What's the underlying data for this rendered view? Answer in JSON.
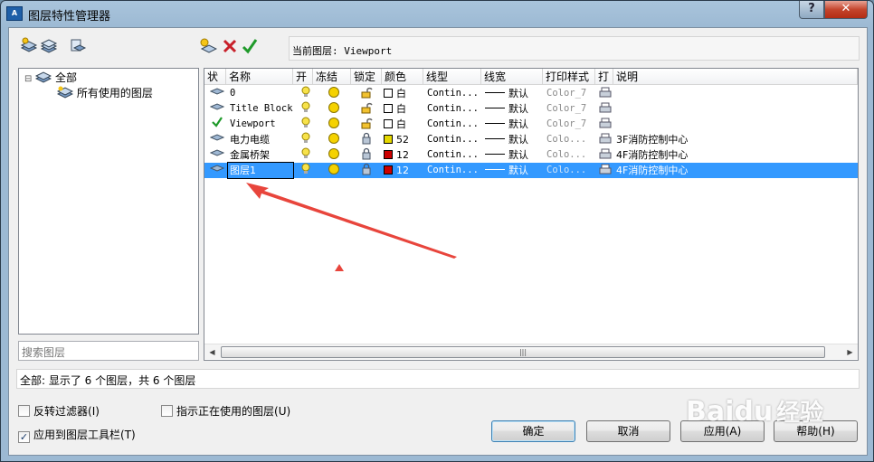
{
  "window": {
    "title": "图层特性管理器",
    "app_icon_text": "A",
    "help_button": "?",
    "close_button": "✕"
  },
  "toolbar": {
    "current_layer_label": "当前图层:",
    "current_layer_value": "Viewport"
  },
  "tree": {
    "root": "全部",
    "child": "所有使用的图层",
    "root_toggle": "⊟"
  },
  "search": {
    "placeholder": "搜索图层"
  },
  "columns": [
    "状",
    "名称",
    "开",
    "冻结",
    "锁定",
    "颜色",
    "线型",
    "线宽",
    "打印样式",
    "打",
    "说明"
  ],
  "layers": [
    {
      "status": "layer",
      "name": "0",
      "color_hex": "#ffffff",
      "color": "白",
      "linetype": "Contin...",
      "lineweight": "默认",
      "plot_style": "Color_7",
      "desc": "",
      "locked": false
    },
    {
      "status": "layer",
      "name": "Title Block",
      "color_hex": "#ffffff",
      "color": "白",
      "linetype": "Contin...",
      "lineweight": "默认",
      "plot_style": "Color_7",
      "desc": "",
      "locked": false
    },
    {
      "status": "current",
      "name": "Viewport",
      "color_hex": "#ffffff",
      "color": "白",
      "linetype": "Contin...",
      "lineweight": "默认",
      "plot_style": "Color_7",
      "desc": "",
      "locked": false
    },
    {
      "status": "layer",
      "name": "电力电缆",
      "color_hex": "#e5d800",
      "color": "52",
      "linetype": "Contin...",
      "lineweight": "默认",
      "plot_style": "Colo...",
      "desc": "3F消防控制中心",
      "locked": true
    },
    {
      "status": "layer",
      "name": "金属桥架",
      "color_hex": "#cc0000",
      "color": "12",
      "linetype": "Contin...",
      "lineweight": "默认",
      "plot_style": "Colo...",
      "desc": "4F消防控制中心",
      "locked": true
    },
    {
      "status": "layer",
      "name": "图层1",
      "color_hex": "#cc0000",
      "color": "12",
      "linetype": "Contin...",
      "lineweight": "默认",
      "plot_style": "Colo...",
      "desc": "4F消防控制中心",
      "locked": true,
      "selected": true
    }
  ],
  "scrollbar": {
    "left": "◀",
    "right": "▶",
    "grip": "|||"
  },
  "status_text": "全部: 显示了 6 个图层，共 6 个图层",
  "options": {
    "invert_filter": "反转过滤器",
    "invert_filter_key": "(I)",
    "invert_checked": false,
    "show_in_use": "指示正在使用的图层",
    "show_in_use_key": "(U)",
    "show_in_use_checked": false,
    "apply_toolbar": "应用到图层工具栏",
    "apply_toolbar_key": "(T)",
    "apply_toolbar_checked": true
  },
  "buttons": {
    "ok": "确定",
    "cancel": "取消",
    "apply": "应用(A)",
    "help": "帮助(H)"
  },
  "watermark": {
    "brand": "Baidu",
    "suffix": "经验"
  },
  "colors": {
    "selection": "#3399ff",
    "arrow": "#e8453c"
  }
}
